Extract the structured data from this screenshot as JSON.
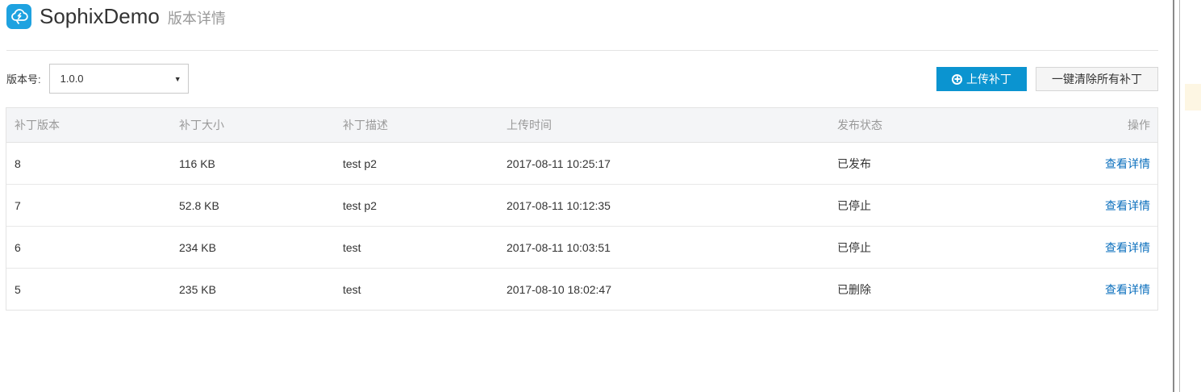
{
  "header": {
    "title": "SophixDemo",
    "subtitle": "版本详情",
    "icon": "cloud-app-icon"
  },
  "filter": {
    "label": "版本号:",
    "selected_version": "1.0.0"
  },
  "actions": {
    "upload_label": "上传补丁",
    "clear_all_label": "一键清除所有补丁"
  },
  "table": {
    "columns": [
      "补丁版本",
      "补丁大小",
      "补丁描述",
      "上传时间",
      "发布状态",
      "操作"
    ],
    "rows": [
      {
        "version": "8",
        "size": "116 KB",
        "desc": "test p2",
        "time": "2017-08-11 10:25:17",
        "status": "已发布",
        "action": "查看详情"
      },
      {
        "version": "7",
        "size": "52.8 KB",
        "desc": "test p2",
        "time": "2017-08-11 10:12:35",
        "status": "已停止",
        "action": "查看详情"
      },
      {
        "version": "6",
        "size": "234 KB",
        "desc": "test",
        "time": "2017-08-11 10:03:51",
        "status": "已停止",
        "action": "查看详情"
      },
      {
        "version": "5",
        "size": "235 KB",
        "desc": "test",
        "time": "2017-08-10 18:02:47",
        "status": "已删除",
        "action": "查看详情"
      }
    ]
  },
  "colors": {
    "accent": "#0b94d0",
    "link": "#0b6fbd",
    "icon_bg": "#1ea2e0"
  }
}
